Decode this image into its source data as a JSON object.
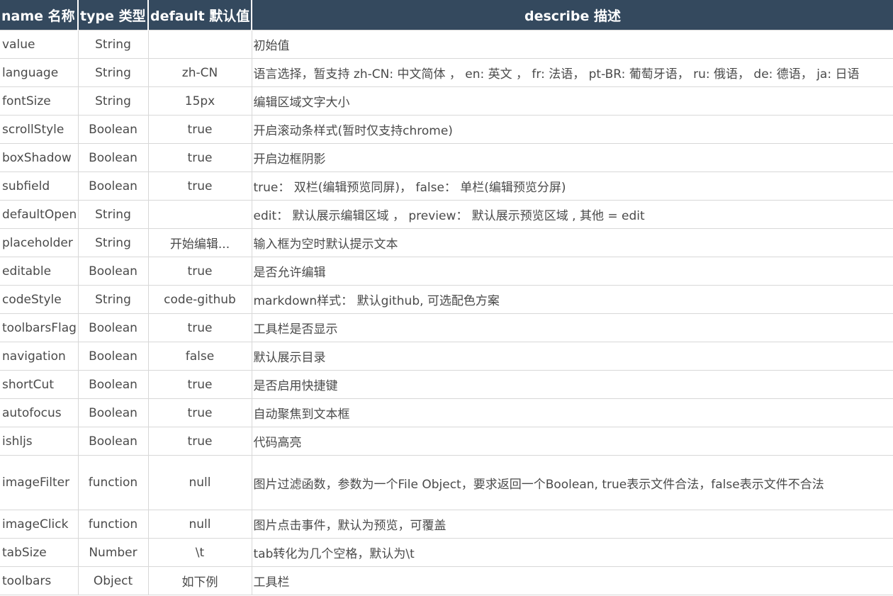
{
  "header": {
    "name": "name 名称",
    "type": "type 类型",
    "default": "default 默认值",
    "describe": "describe 描述"
  },
  "rows": [
    {
      "name": "value",
      "type": "String",
      "default": "",
      "describe": "初始值"
    },
    {
      "name": "language",
      "type": "String",
      "default": "zh-CN",
      "describe": "语言选择，暂支持 zh-CN: 中文简体 ， en: 英文 ， fr: 法语， pt-BR: 葡萄牙语， ru: 俄语， de: 德语， ja: 日语"
    },
    {
      "name": "fontSize",
      "type": "String",
      "default": "15px",
      "describe": "编辑区域文字大小"
    },
    {
      "name": "scrollStyle",
      "type": "Boolean",
      "default": "true",
      "describe": "开启滚动条样式(暂时仅支持chrome)"
    },
    {
      "name": "boxShadow",
      "type": "Boolean",
      "default": "true",
      "describe": "开启边框阴影"
    },
    {
      "name": "subfield",
      "type": "Boolean",
      "default": "true",
      "describe": "true： 双栏(编辑预览同屏)， false： 单栏(编辑预览分屏)"
    },
    {
      "name": "defaultOpen",
      "type": "String",
      "default": "",
      "describe": "edit： 默认展示编辑区域 ， preview： 默认展示预览区域 , 其他 = edit"
    },
    {
      "name": "placeholder",
      "type": "String",
      "default": "开始编辑...",
      "describe": "输入框为空时默认提示文本"
    },
    {
      "name": "editable",
      "type": "Boolean",
      "default": "true",
      "describe": "是否允许编辑"
    },
    {
      "name": "codeStyle",
      "type": "String",
      "default": "code-github",
      "describe": "markdown样式： 默认github, 可选配色方案"
    },
    {
      "name": "toolbarsFlag",
      "type": "Boolean",
      "default": "true",
      "describe": "工具栏是否显示"
    },
    {
      "name": "navigation",
      "type": "Boolean",
      "default": "false",
      "describe": "默认展示目录"
    },
    {
      "name": "shortCut",
      "type": "Boolean",
      "default": "true",
      "describe": "是否启用快捷键"
    },
    {
      "name": "autofocus",
      "type": "Boolean",
      "default": "true",
      "describe": "自动聚焦到文本框"
    },
    {
      "name": "ishljs",
      "type": "Boolean",
      "default": "true",
      "describe": "代码高亮"
    },
    {
      "name": "imageFilter",
      "type": "function",
      "default": "null",
      "describe": "图片过滤函数，参数为一个File Object，要求返回一个Boolean, true表示文件合法，false表示文件不合法"
    },
    {
      "name": "imageClick",
      "type": "function",
      "default": "null",
      "describe": "图片点击事件，默认为预览，可覆盖"
    },
    {
      "name": "tabSize",
      "type": "Number",
      "default": "\\t",
      "describe": "tab转化为几个空格，默认为\\t"
    },
    {
      "name": "toolbars",
      "type": "Object",
      "default": "如下例",
      "describe": "工具栏"
    }
  ]
}
